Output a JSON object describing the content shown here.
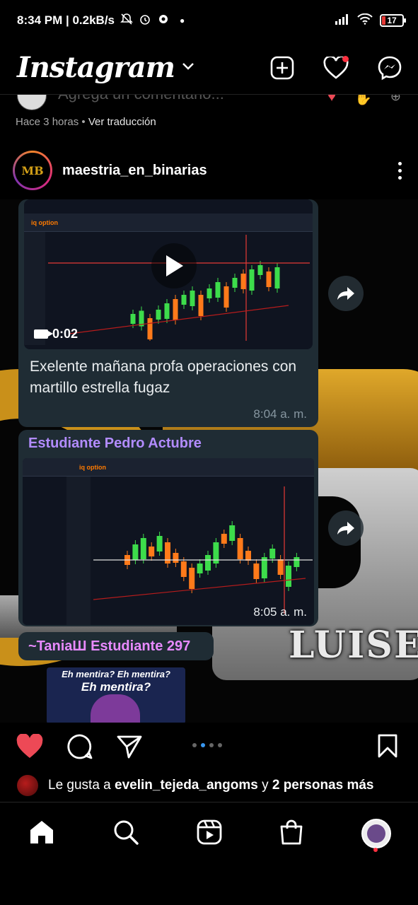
{
  "status_bar": {
    "time_speed": "8:34 PM | 0.2kB/s",
    "battery": "17",
    "icons": [
      "mute-icon",
      "alarm-icon",
      "cloud-icon",
      "dot-icon",
      "signal-icon",
      "wifi-icon",
      "battery-icon"
    ]
  },
  "header": {
    "title": "Instagram",
    "icons": [
      "chevron-down-icon",
      "new-post-icon",
      "heart-icon",
      "messenger-icon"
    ]
  },
  "previous_post": {
    "comment_placeholder": "Agrega un comentario...",
    "time": "Hace 3 horas",
    "separator": "•",
    "translate": "Ver traducción"
  },
  "post": {
    "username": "maestria_en_binarias",
    "avatar_text": "MB",
    "background_watermark": "LUISE",
    "chat": {
      "video_duration": "0:02",
      "message_1": "Exelente mañana profa operaciones con martillo estrella fugaz",
      "time_1": "8:04 a. m.",
      "sender_2": "Estudiante Pedro Actubre",
      "time_2": "8:05 a. m.",
      "sender_3": "~TaniaШ Estudiante 297",
      "meme_top": "Eh mentira? Eh mentira?",
      "meme_main": "Eh mentira?",
      "broker": "iq option"
    },
    "carousel": {
      "count": 4,
      "active": 1
    },
    "likes": {
      "prefix": "Le gusta a",
      "user": "evelin_tejeda_angoms",
      "conjunction": "y",
      "others": "2 personas más"
    }
  },
  "bottom_nav": {
    "items": [
      "home-icon",
      "search-icon",
      "reels-icon",
      "shop-icon",
      "profile-avatar"
    ]
  },
  "colors": {
    "like_red": "#ed4956",
    "notification_red": "#ff3040",
    "carousel_active": "#3897f0",
    "chat_bubble": "#1f2c34",
    "gold": "#c9901a",
    "candle_green": "#3ddc4b",
    "candle_orange": "#ff7a1a"
  },
  "chart_candles_1": [
    [
      40,
      48,
      "g"
    ],
    [
      48,
      45,
      "g"
    ],
    [
      56,
      52,
      "o"
    ],
    [
      64,
      44,
      "g"
    ],
    [
      72,
      38,
      "g"
    ],
    [
      80,
      34,
      "o"
    ],
    [
      88,
      30,
      "g"
    ],
    [
      96,
      26,
      "g"
    ],
    [
      104,
      30,
      "o"
    ],
    [
      112,
      24,
      "g"
    ],
    [
      120,
      18,
      "g"
    ],
    [
      128,
      22,
      "o"
    ],
    [
      136,
      14,
      "g"
    ],
    [
      144,
      10,
      "o"
    ],
    [
      152,
      6,
      "g"
    ],
    [
      160,
      2,
      "g"
    ],
    [
      168,
      8,
      "o"
    ],
    [
      176,
      4,
      "g"
    ]
  ],
  "chart_candles_2": [
    [
      40,
      38,
      "o"
    ],
    [
      52,
      28,
      "g"
    ],
    [
      64,
      22,
      "g"
    ],
    [
      76,
      30,
      "o"
    ],
    [
      88,
      20,
      "g"
    ],
    [
      100,
      26,
      "o"
    ],
    [
      112,
      36,
      "o"
    ],
    [
      124,
      44,
      "o"
    ],
    [
      136,
      50,
      "o"
    ],
    [
      148,
      46,
      "g"
    ],
    [
      160,
      38,
      "g"
    ],
    [
      172,
      26,
      "g"
    ],
    [
      184,
      18,
      "o"
    ],
    [
      196,
      10,
      "g"
    ],
    [
      208,
      22,
      "o"
    ],
    [
      220,
      34,
      "o"
    ],
    [
      232,
      46,
      "o"
    ],
    [
      244,
      40,
      "g"
    ],
    [
      256,
      32,
      "g"
    ],
    [
      268,
      42,
      "o"
    ],
    [
      280,
      48,
      "g"
    ],
    [
      292,
      40,
      "g"
    ]
  ]
}
